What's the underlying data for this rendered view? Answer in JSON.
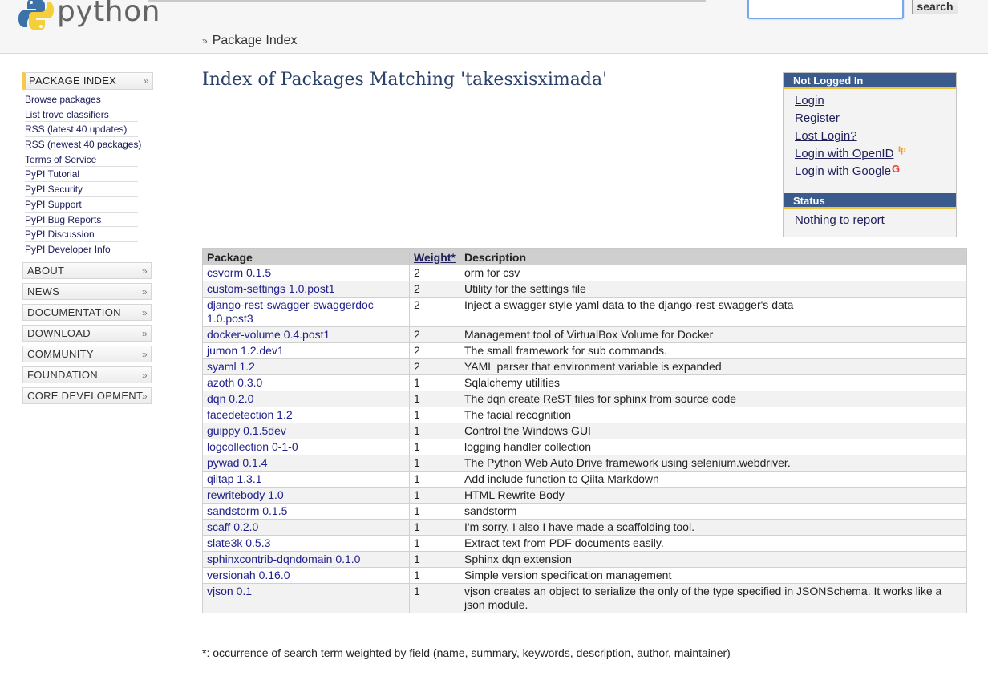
{
  "header": {
    "logo_text": "python",
    "search_button": "search",
    "breadcrumb_sep": "»",
    "breadcrumb": "Package Index"
  },
  "nav": {
    "main": "PACKAGE INDEX",
    "links": [
      "Browse packages",
      "List trove classifiers",
      "RSS (latest 40 updates)",
      "RSS (newest 40 packages)",
      "Terms of Service",
      "PyPI Tutorial",
      "PyPI Security",
      "PyPI Support",
      "PyPI Bug Reports",
      "PyPI Discussion",
      "PyPI Developer Info"
    ],
    "sections": [
      "ABOUT",
      "NEWS",
      "DOCUMENTATION",
      "DOWNLOAD",
      "COMMUNITY",
      "FOUNDATION",
      "CORE DEVELOPMENT"
    ],
    "chevron": "»"
  },
  "title": "Index of Packages Matching 'takesxisximada'",
  "login_box": {
    "heading": "Not Logged In",
    "links": [
      "Login",
      "Register",
      "Lost Login?",
      "Login with OpenID",
      "Login with Google"
    ],
    "openid_badge": "Ip",
    "google_badge": "G"
  },
  "status_box": {
    "heading": "Status",
    "text": "Nothing to report"
  },
  "table": {
    "headers": [
      "Package",
      "Weight*",
      "Description"
    ],
    "rows": [
      {
        "pkg": "csvorm 0.1.5",
        "weight": "2",
        "desc": "orm for csv"
      },
      {
        "pkg": "custom-settings 1.0.post1",
        "weight": "2",
        "desc": "Utility for the settings file"
      },
      {
        "pkg": "django-rest-swagger-swaggerdoc 1.0.post3",
        "weight": "2",
        "desc": "Inject a swagger style yaml data to the django-rest-swagger's data"
      },
      {
        "pkg": "docker-volume 0.4.post1",
        "weight": "2",
        "desc": "Management tool of VirtualBox Volume for Docker"
      },
      {
        "pkg": "jumon 1.2.dev1",
        "weight": "2",
        "desc": "The small framework for sub commands."
      },
      {
        "pkg": "syaml 1.2",
        "weight": "2",
        "desc": "YAML parser that environment variable is expanded"
      },
      {
        "pkg": "azoth 0.3.0",
        "weight": "1",
        "desc": "Sqlalchemy utilities"
      },
      {
        "pkg": "dqn 0.2.0",
        "weight": "1",
        "desc": "The dqn create ReST files for sphinx from source code"
      },
      {
        "pkg": "facedetection 1.2",
        "weight": "1",
        "desc": "The facial recognition"
      },
      {
        "pkg": "guippy 0.1.5dev",
        "weight": "1",
        "desc": "Control the Windows GUI"
      },
      {
        "pkg": "logcollection 0-1-0",
        "weight": "1",
        "desc": "logging handler collection"
      },
      {
        "pkg": "pywad 0.1.4",
        "weight": "1",
        "desc": "The Python Web Auto Drive framework using selenium.webdriver."
      },
      {
        "pkg": "qiitap 1.3.1",
        "weight": "1",
        "desc": "Add include function to Qiita Markdown"
      },
      {
        "pkg": "rewritebody 1.0",
        "weight": "1",
        "desc": "HTML Rewrite Body"
      },
      {
        "pkg": "sandstorm 0.1.5",
        "weight": "1",
        "desc": "sandstorm"
      },
      {
        "pkg": "scaff 0.2.0",
        "weight": "1",
        "desc": "I'm sorry, I also I have made a scaffolding tool."
      },
      {
        "pkg": "slate3k 0.5.3",
        "weight": "1",
        "desc": "Extract text from PDF documents easily."
      },
      {
        "pkg": "sphinxcontrib-dqndomain 0.1.0",
        "weight": "1",
        "desc": "Sphinx dqn extension"
      },
      {
        "pkg": "versionah 0.16.0",
        "weight": "1",
        "desc": "Simple version specification management"
      },
      {
        "pkg": "vjson 0.1",
        "weight": "1",
        "desc": "vjson creates an object to serialize the only of the type specified in JSONSchema. It works like a json module."
      }
    ]
  },
  "footnote": "*: occurrence of search term weighted by field (name, summary, keywords, description, author, maintainer)"
}
